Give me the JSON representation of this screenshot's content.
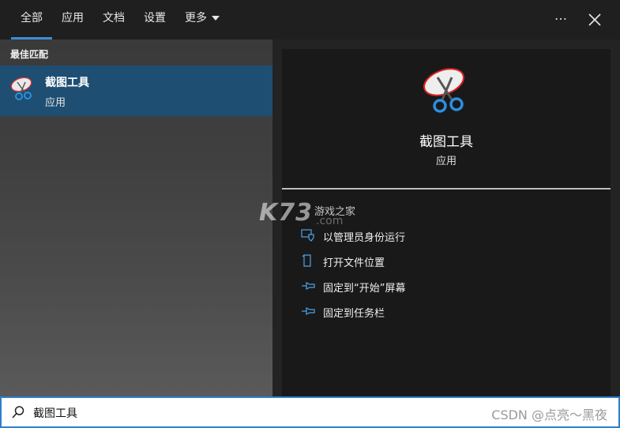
{
  "tabs": [
    {
      "label": "全部",
      "active": true
    },
    {
      "label": "应用",
      "active": false
    },
    {
      "label": "文档",
      "active": false
    },
    {
      "label": "设置",
      "active": false
    },
    {
      "label": "更多",
      "active": false,
      "dropdown": true
    }
  ],
  "header_icons": {
    "more": "…",
    "close": "close-icon"
  },
  "left": {
    "section_title": "最佳匹配",
    "best_match": {
      "name": "截图工具",
      "type": "应用",
      "icon": "snipping-tool-icon"
    }
  },
  "detail": {
    "name": "截图工具",
    "type": "应用",
    "actions": [
      {
        "label": "以管理员身份运行",
        "icon": "shield-run-admin-icon"
      },
      {
        "label": "打开文件位置",
        "icon": "file-location-icon"
      },
      {
        "label": "固定到“开始”屏幕",
        "icon": "pin-icon"
      },
      {
        "label": "固定到任务栏",
        "icon": "pin-icon"
      }
    ]
  },
  "watermark": {
    "brand": "K73",
    "site": "游戏之家",
    "domain": ".com"
  },
  "search": {
    "query": "截图工具",
    "icon": "search-icon"
  },
  "credit": "CSDN @点亮～黑夜",
  "colors": {
    "accent": "#3a8fd6",
    "selected_bg": "#1e4e72",
    "panel_bg": "#191919"
  }
}
